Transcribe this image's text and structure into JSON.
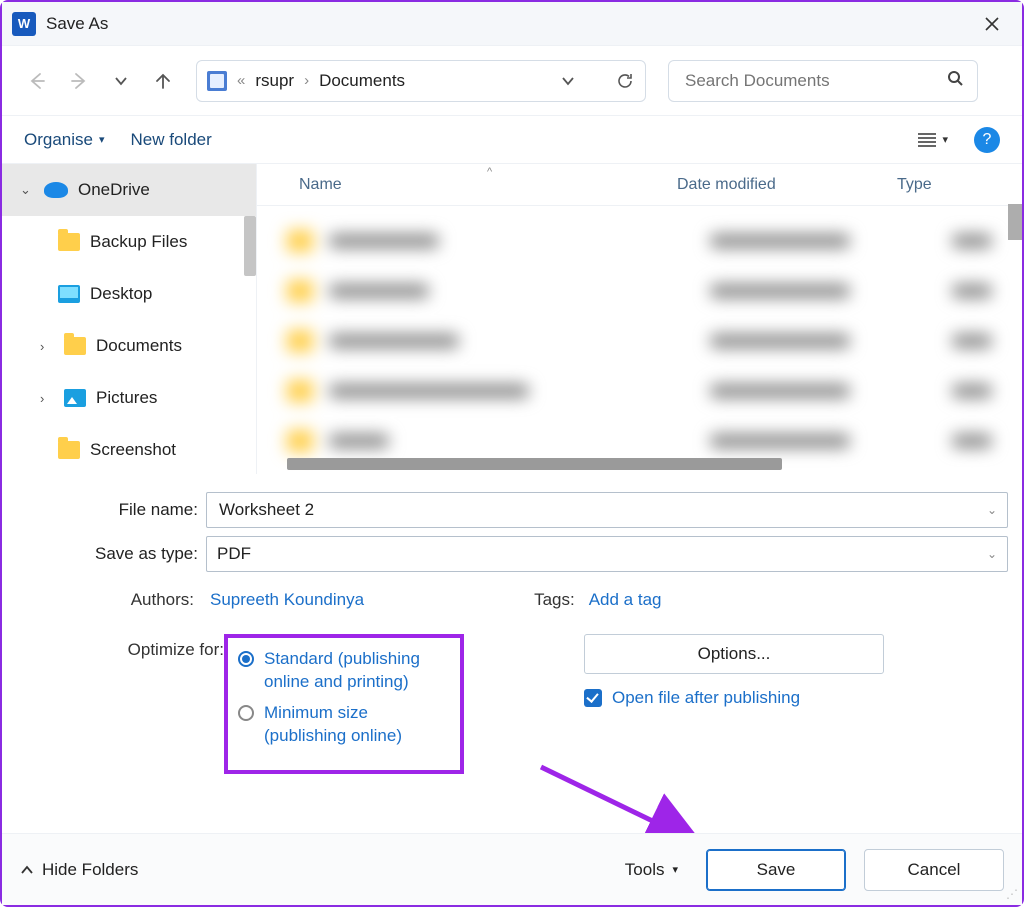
{
  "title": "Save As",
  "breadcrumb": {
    "seg1": "rsupr",
    "seg2": "Documents"
  },
  "search": {
    "placeholder": "Search Documents"
  },
  "toolbar": {
    "organise_label": "Organise",
    "newfolder_label": "New folder"
  },
  "tree": {
    "onedrive": "OneDrive",
    "backup": "Backup Files",
    "desktop": "Desktop",
    "documents": "Documents",
    "pictures": "Pictures",
    "screenshot": "Screenshot"
  },
  "list": {
    "col_name": "Name",
    "col_date": "Date modified",
    "col_type": "Type"
  },
  "form": {
    "filename_label": "File name:",
    "filename_value": "Worksheet 2",
    "savetype_label": "Save as type:",
    "savetype_value": "PDF",
    "authors_label": "Authors:",
    "authors_value": "Supreeth Koundinya",
    "tags_label": "Tags:",
    "tags_value": "Add a tag",
    "optimize_label": "Optimize for:",
    "opt_standard": "Standard (publishing online and printing)",
    "opt_minimum": "Minimum size (publishing online)",
    "options_btn": "Options...",
    "open_after": "Open file after publishing"
  },
  "footer": {
    "hide_folders": "Hide Folders",
    "tools": "Tools",
    "save": "Save",
    "cancel": "Cancel"
  }
}
